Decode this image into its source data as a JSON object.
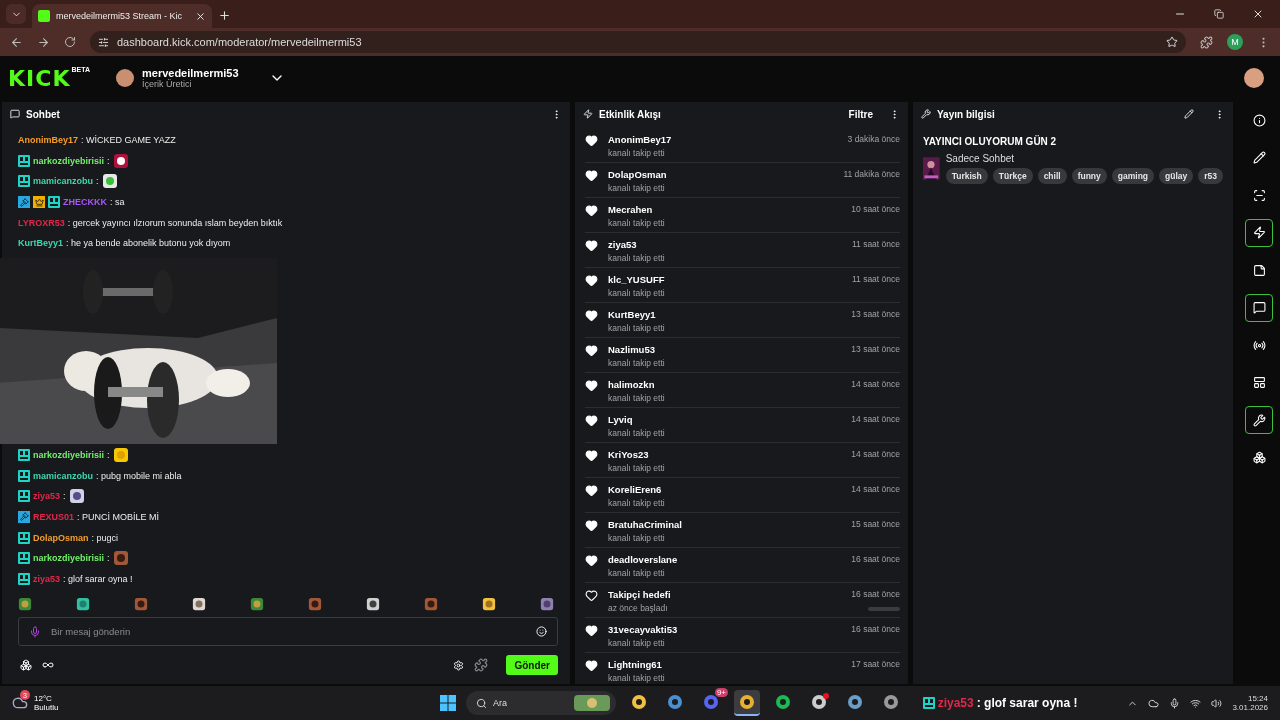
{
  "browser": {
    "tab": {
      "title": "mervedeilmermi53 Stream - Kic"
    },
    "url": "dashboard.kick.com/moderator/mervedeilmermi53",
    "profile_initial": "M"
  },
  "header": {
    "logo": "KICK",
    "logo_badge": "BETA",
    "channel": "mervedeilmermi53",
    "role": "İçerik Üretici"
  },
  "chat": {
    "title": "Sohbet",
    "messages": [
      {
        "kind": "text",
        "moderator": false,
        "vip": false,
        "og": false,
        "username": "AnonimBey17",
        "color": "#f59e2b",
        "text": ": WİCKED GAME YAZZ"
      },
      {
        "kind": "emote",
        "moderator": false,
        "vip": false,
        "og": true,
        "username": "narkozdiyebirisii",
        "color": "#72f06a",
        "text": ":"
      },
      {
        "kind": "emote",
        "moderator": false,
        "vip": false,
        "og": true,
        "username": "mamicanzobu",
        "color": "#3ed6b0",
        "text": ":"
      },
      {
        "kind": "text",
        "moderator": true,
        "vip": true,
        "og": true,
        "username": "ZHECKKK",
        "color": "#a855f7",
        "text": ": sa"
      },
      {
        "kind": "text",
        "moderator": false,
        "vip": false,
        "og": false,
        "username": "LYROXR53",
        "color": "#e0284a",
        "text": ": gercek yayıncı ılzıorum sonunda ıslam beyden bıktık"
      },
      {
        "kind": "text",
        "moderator": false,
        "vip": false,
        "og": false,
        "username": "KurtBeyy1",
        "color": "#3ed6b0",
        "text": ": he ya bende abonelik butonu yok dıyom"
      },
      {
        "kind": "emote",
        "moderator": false,
        "vip": false,
        "og": true,
        "username": "narkozdiyebirisii",
        "color": "#72f06a",
        "text": ":"
      },
      {
        "kind": "text",
        "moderator": false,
        "vip": false,
        "og": true,
        "username": "mamicanzobu",
        "color": "#3ed6b0",
        "text": ": pubg mobile mi abla"
      },
      {
        "kind": "emote",
        "moderator": false,
        "vip": false,
        "og": true,
        "username": "ziya53",
        "color": "#e0284a",
        "text": ":"
      },
      {
        "kind": "text",
        "moderator": true,
        "vip": false,
        "og": false,
        "username": "REXUS01",
        "color": "#e0284a",
        "text": ": PUNCİ MOBİLE Mİ"
      },
      {
        "kind": "text",
        "moderator": false,
        "vip": false,
        "og": true,
        "username": "DolapOsman",
        "color": "#f59e2b",
        "text": ": pugci"
      },
      {
        "kind": "emote",
        "moderator": false,
        "vip": false,
        "og": true,
        "username": "narkozdiyebirisii",
        "color": "#72f06a",
        "text": ":"
      },
      {
        "kind": "text",
        "moderator": false,
        "vip": false,
        "og": true,
        "username": "ziya53",
        "color": "#e0284a",
        "text": ": glof sarar oyna !"
      }
    ],
    "input": {
      "placeholder": "Bir mesaj gönderin"
    },
    "send_button": "Gönder"
  },
  "events": {
    "title": "Etkinlik Akışı",
    "filter": "Filtre",
    "items": [
      {
        "kind": "follow",
        "username": "AnonimBey17",
        "description": "kanalı takip etti",
        "time": "3 dakika önce"
      },
      {
        "kind": "follow",
        "username": "DolapOsman",
        "description": "kanalı takip etti",
        "time": "11 dakika önce"
      },
      {
        "kind": "follow",
        "username": "Mecrahen",
        "description": "kanalı takip etti",
        "time": "10 saat önce"
      },
      {
        "kind": "follow",
        "username": "ziya53",
        "description": "kanalı takip etti",
        "time": "11 saat önce"
      },
      {
        "kind": "follow",
        "username": "klc_YUSUFF",
        "description": "kanalı takip etti",
        "time": "11 saat önce"
      },
      {
        "kind": "follow",
        "username": "KurtBeyy1",
        "description": "kanalı takip etti",
        "time": "13 saat önce"
      },
      {
        "kind": "follow",
        "username": "Nazlimu53",
        "description": "kanalı takip etti",
        "time": "13 saat önce"
      },
      {
        "kind": "follow",
        "username": "halimozkn",
        "description": "kanalı takip etti",
        "time": "14 saat önce"
      },
      {
        "kind": "follow",
        "username": "Lyviq",
        "description": "kanalı takip etti",
        "time": "14 saat önce"
      },
      {
        "kind": "follow",
        "username": "KriYos23",
        "description": "kanalı takip etti",
        "time": "14 saat önce"
      },
      {
        "kind": "follow",
        "username": "KoreliEren6",
        "description": "kanalı takip etti",
        "time": "14 saat önce"
      },
      {
        "kind": "follow",
        "username": "BratuhaCriminal",
        "description": "kanalı takip etti",
        "time": "15 saat önce"
      },
      {
        "kind": "follow",
        "username": "deadloverslane",
        "description": "kanalı takip etti",
        "time": "16 saat önce"
      },
      {
        "kind": "goal",
        "username": "Takipçi hedefi",
        "description": "az önce başladı",
        "time": "16 saat önce",
        "level": 0
      },
      {
        "kind": "follow",
        "username": "31vecayvakti53",
        "description": "kanalı takip etti",
        "time": "16 saat önce"
      },
      {
        "kind": "follow",
        "username": "Lightning61",
        "description": "kanalı takip etti",
        "time": "17 saat önce"
      }
    ]
  },
  "stream_info": {
    "title": "Yayın bilgisi",
    "stream_title": "YAYINCI OLUYORUM GÜN 2",
    "category": "Sadece Sohbet",
    "tags": [
      "Turkish",
      "Türkçe",
      "chill",
      "funny",
      "gaming",
      "gülay",
      "r53"
    ]
  },
  "side_tools": [
    {
      "kind": "info",
      "active": false
    },
    {
      "kind": "edit",
      "active": false
    },
    {
      "kind": "focus",
      "active": false
    },
    {
      "kind": "events",
      "active": true
    },
    {
      "kind": "notes",
      "active": false
    },
    {
      "kind": "chat",
      "active": true
    },
    {
      "kind": "broadcast",
      "active": false
    },
    {
      "kind": "layout",
      "active": false
    },
    {
      "kind": "tools",
      "active": true
    },
    {
      "kind": "apps",
      "active": false
    }
  ],
  "taskbar": {
    "weather": {
      "badge": "3",
      "temp": "12°C",
      "condition": "Bulutlu"
    },
    "search_placeholder": "Ara",
    "apps": [
      {
        "kind": "files",
        "selected": false,
        "notification": false
      },
      {
        "kind": "cube",
        "selected": false,
        "notification": false
      },
      {
        "kind": "chat",
        "selected": false,
        "notification": false,
        "badge": "9+"
      },
      {
        "kind": "browser",
        "selected": true,
        "notification": false
      },
      {
        "kind": "music",
        "selected": false,
        "notification": false
      },
      {
        "kind": "record",
        "selected": false,
        "notification": true
      },
      {
        "kind": "steam",
        "selected": false,
        "notification": false
      },
      {
        "kind": "game",
        "selected": false,
        "notification": false
      }
    ],
    "overlay": {
      "username": "ziya53",
      "text": ": glof sarar oyna !"
    },
    "clock": {
      "time": "15:24",
      "date": "3.01.2026"
    }
  }
}
